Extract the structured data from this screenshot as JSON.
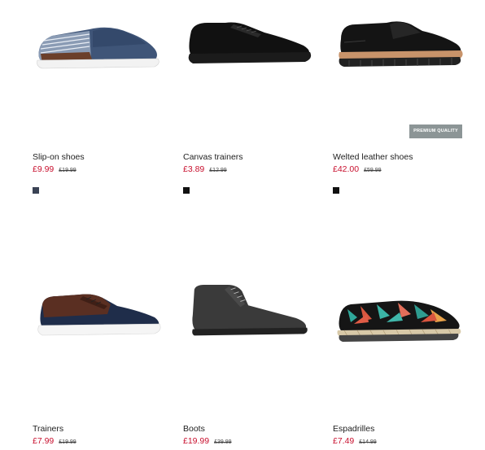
{
  "badge": {
    "label": "PREMIUM QUALITY"
  },
  "products": [
    {
      "name": "Slip-on shoes",
      "price": "£9.99",
      "old_price": "£19.99",
      "swatch_color": "#3a4254"
    },
    {
      "name": "Canvas trainers",
      "price": "£3.89",
      "old_price": "£12.99",
      "swatch_color": "#111111"
    },
    {
      "name": "Welted leather shoes",
      "price": "£42.00",
      "old_price": "£59.99",
      "swatch_color": "#111111"
    },
    {
      "name": "Trainers",
      "price": "£7.99",
      "old_price": "£19.99"
    },
    {
      "name": "Boots",
      "price": "£19.99",
      "old_price": "£39.99"
    },
    {
      "name": "Espadrilles",
      "price": "£7.49",
      "old_price": "£14.99"
    }
  ],
  "colors": {
    "sale_price": "#c8102e",
    "badge_bg": "#8c9596"
  }
}
